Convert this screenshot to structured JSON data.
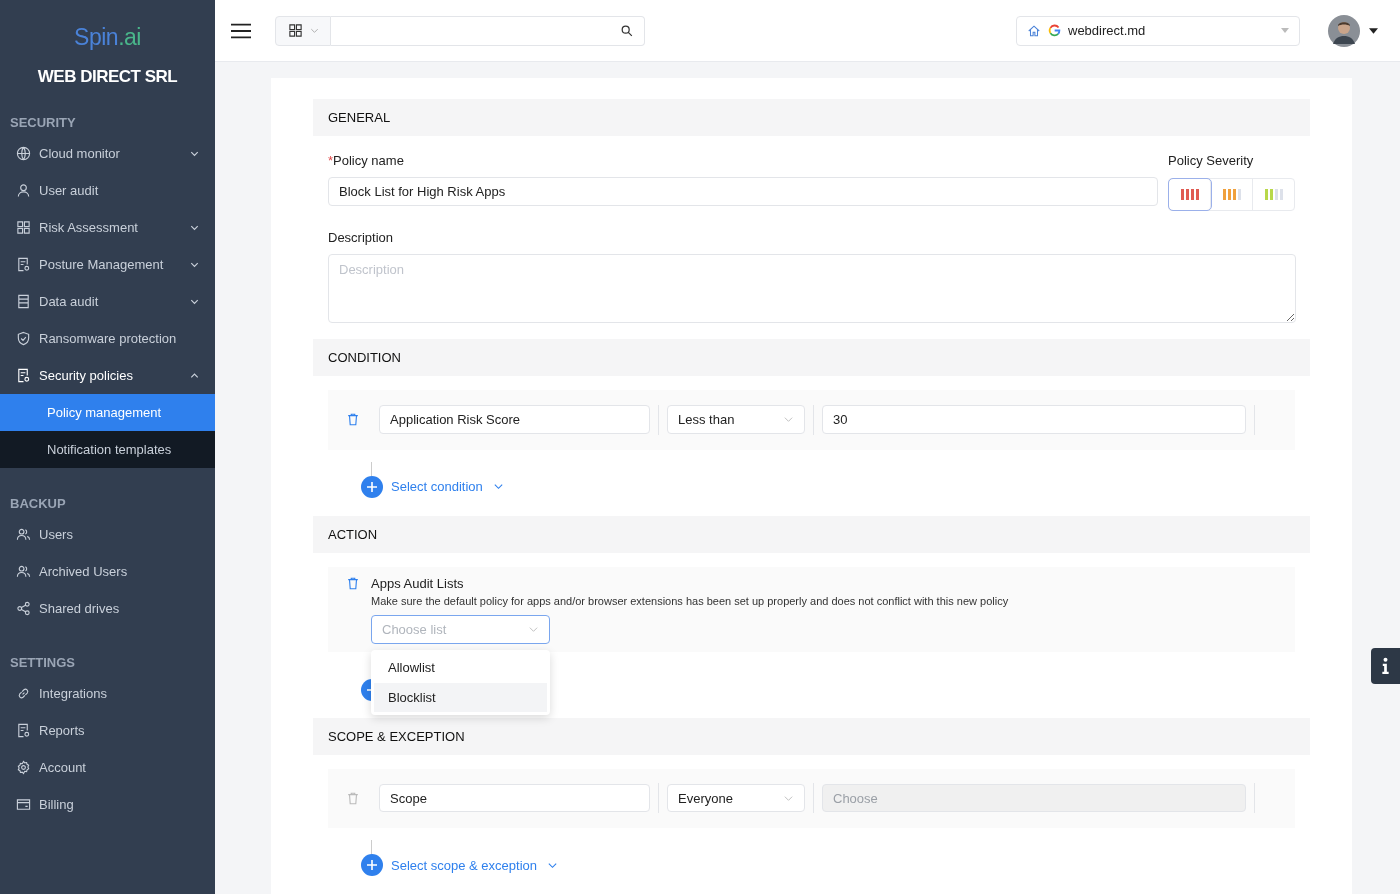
{
  "sidebar": {
    "logo": {
      "part_1": "Spin",
      "part_2": ".ai"
    },
    "company": "WEB DIRECT SRL",
    "sections": [
      {
        "title": "SECURITY",
        "items": [
          {
            "label": "Cloud monitor",
            "expanded": false
          },
          {
            "label": "User audit"
          },
          {
            "label": "Risk Assessment",
            "expanded": false
          },
          {
            "label": "Posture Management",
            "expanded": false
          },
          {
            "label": "Data audit",
            "expanded": false
          },
          {
            "label": "Ransomware protection"
          },
          {
            "label": "Security policies",
            "expanded": true,
            "children": [
              {
                "label": "Policy management",
                "selected": true
              },
              {
                "label": "Notification templates",
                "selected": false
              }
            ]
          }
        ]
      },
      {
        "title": "BACKUP",
        "items": [
          {
            "label": "Users"
          },
          {
            "label": "Archived Users"
          },
          {
            "label": "Shared drives"
          }
        ]
      },
      {
        "title": "SETTINGS",
        "items": [
          {
            "label": "Integrations"
          },
          {
            "label": "Reports"
          },
          {
            "label": "Account"
          },
          {
            "label": "Billing"
          }
        ]
      }
    ]
  },
  "topbar": {
    "domain": "webdirect.md"
  },
  "general": {
    "title": "GENERAL",
    "policy_name": {
      "label": "Policy name",
      "required_mark": "*",
      "value": "Block List for High Risk Apps"
    },
    "severity": {
      "label": "Policy Severity",
      "options": [
        {
          "selected": true,
          "level": 1,
          "color": "#e05a52"
        },
        {
          "selected": false,
          "level": 0.75,
          "color": "#f0a03c"
        },
        {
          "selected": false,
          "level": 0.5,
          "color": "#b8d84a"
        }
      ]
    },
    "description": {
      "label": "Description",
      "placeholder": "Description"
    }
  },
  "condition": {
    "title": "CONDITION",
    "rows": [
      {
        "field": "Application Risk Score",
        "operator": "Less than",
        "value": "30",
        "disabled": false
      }
    ],
    "add_label": "Select condition"
  },
  "action": {
    "title": "ACTION",
    "items": [
      {
        "title": "Apps Audit Lists",
        "note": "Make sure the default policy for apps and/or browser extensions has been set up properly and does not conflict with this new policy",
        "placeholder": "Choose list",
        "open": true,
        "options": [
          {
            "label": "Allowlist",
            "highlighted": false
          },
          {
            "label": "Blocklist",
            "highlighted": true
          }
        ]
      }
    ]
  },
  "scope": {
    "title": "SCOPE & EXCEPTION",
    "rows": [
      {
        "field": "Scope",
        "operator": "Everyone",
        "placeholder": "Choose",
        "disabled": true
      }
    ],
    "add_label": "Select scope & exception"
  }
}
